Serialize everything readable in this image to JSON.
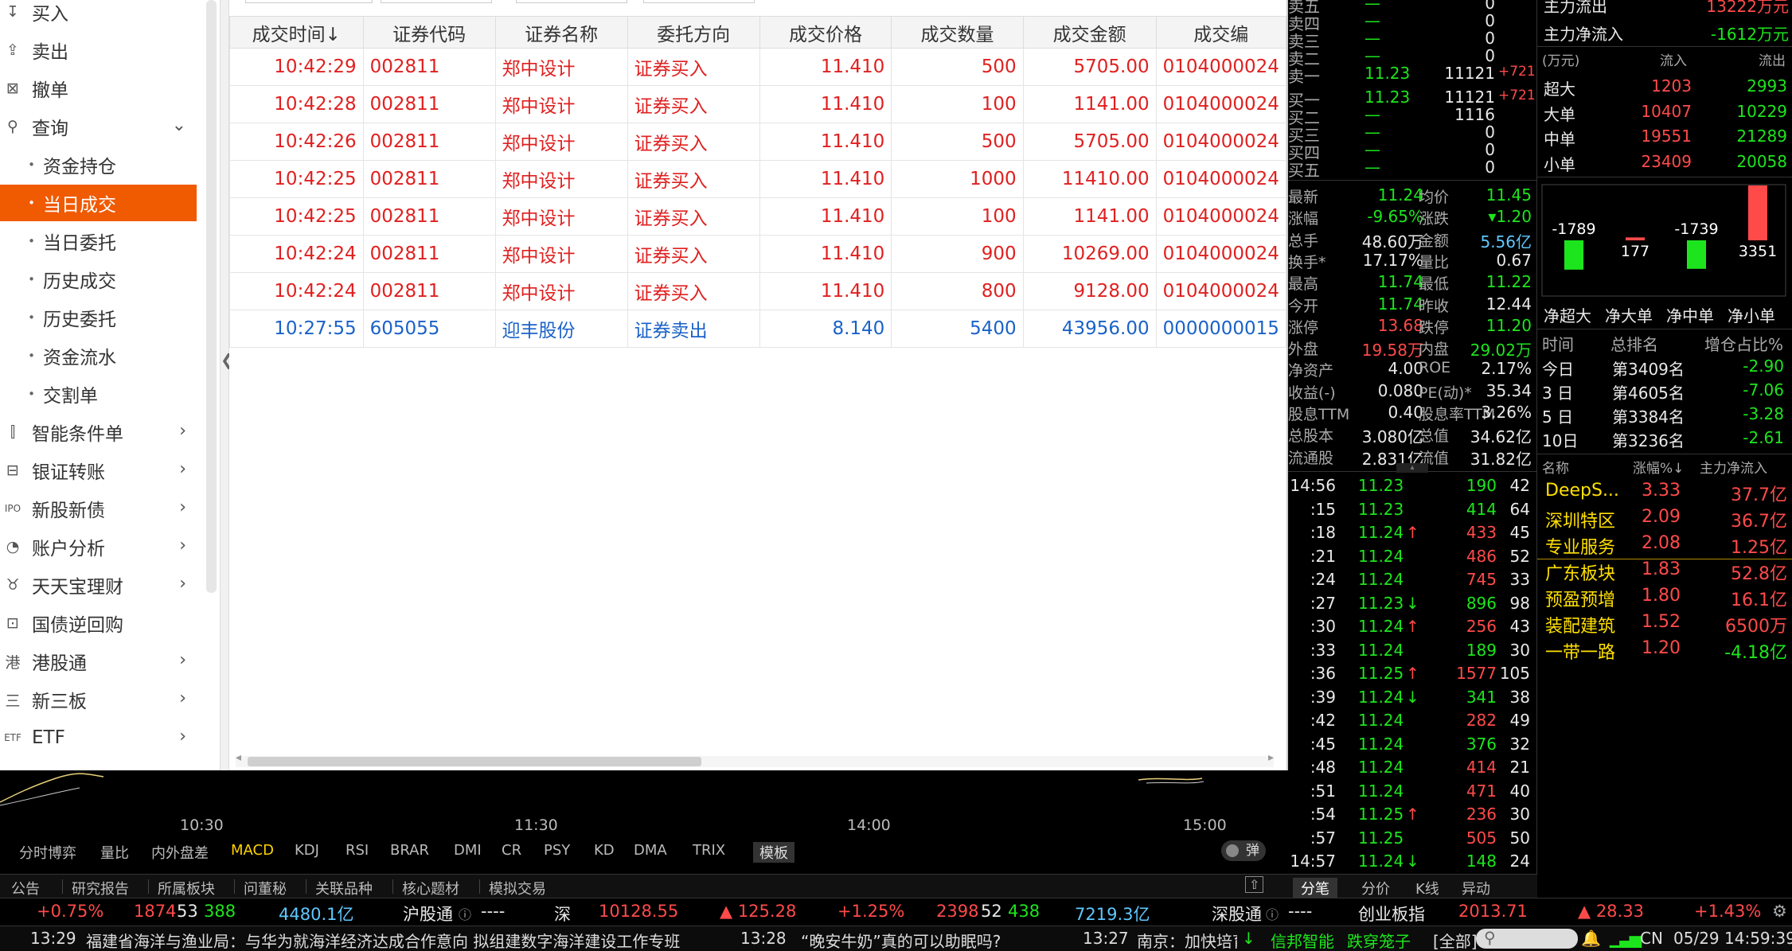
{
  "sidebar": {
    "top_items": [
      {
        "label": "买入",
        "icon": "buy-icon",
        "glyph": "↧"
      },
      {
        "label": "卖出",
        "icon": "sell-icon",
        "glyph": "⇪"
      },
      {
        "label": "撤单",
        "icon": "cancel-order-icon",
        "glyph": "⊠"
      },
      {
        "label": "查询",
        "icon": "search-icon",
        "glyph": "⚲",
        "expanded": true
      }
    ],
    "query_sub": [
      "资金持仓",
      "当日成交",
      "当日委托",
      "历史成交",
      "历史委托",
      "资金流水",
      "交割单"
    ],
    "active_sub": "当日成交",
    "bottom_items": [
      {
        "label": "智能条件单",
        "icon": "smart-order-icon",
        "glyph": "⫿",
        "chevron": true
      },
      {
        "label": "银证转账",
        "icon": "transfer-icon",
        "glyph": "⊟",
        "chevron": true
      },
      {
        "label": "新股新债",
        "icon": "ipo-icon",
        "glyph": "IPO",
        "chevron": true
      },
      {
        "label": "账户分析",
        "icon": "pie-chart-icon",
        "glyph": "◔",
        "chevron": true
      },
      {
        "label": "天天宝理财",
        "icon": "piggy-bank-icon",
        "glyph": "♉",
        "chevron": true
      },
      {
        "label": "国债逆回购",
        "icon": "bond-icon",
        "glyph": "⊡",
        "chevron": false
      },
      {
        "label": "港股通",
        "icon": "hk-connect-icon",
        "glyph": "港",
        "chevron": true
      },
      {
        "label": "新三板",
        "icon": "neeq-icon",
        "glyph": "三",
        "chevron": true
      },
      {
        "label": "ETF",
        "icon": "etf-icon",
        "glyph": "ETF",
        "chevron": true
      }
    ]
  },
  "trades": {
    "columns": [
      "成交时间↓",
      "证券代码",
      "证券名称",
      "委托方向",
      "成交价格",
      "成交数量",
      "成交金额",
      "成交编"
    ],
    "rows": [
      {
        "time": "10:42:29",
        "code": "002811",
        "name": "郑中设计",
        "side": "证券买入",
        "price": "11.410",
        "qty": "500",
        "amount": "5705.00",
        "no": "0104000024",
        "dir": "buy"
      },
      {
        "time": "10:42:28",
        "code": "002811",
        "name": "郑中设计",
        "side": "证券买入",
        "price": "11.410",
        "qty": "100",
        "amount": "1141.00",
        "no": "0104000024",
        "dir": "buy"
      },
      {
        "time": "10:42:26",
        "code": "002811",
        "name": "郑中设计",
        "side": "证券买入",
        "price": "11.410",
        "qty": "500",
        "amount": "5705.00",
        "no": "0104000024",
        "dir": "buy"
      },
      {
        "time": "10:42:25",
        "code": "002811",
        "name": "郑中设计",
        "side": "证券买入",
        "price": "11.410",
        "qty": "1000",
        "amount": "11410.00",
        "no": "0104000024",
        "dir": "buy"
      },
      {
        "time": "10:42:25",
        "code": "002811",
        "name": "郑中设计",
        "side": "证券买入",
        "price": "11.410",
        "qty": "100",
        "amount": "1141.00",
        "no": "0104000024",
        "dir": "buy"
      },
      {
        "time": "10:42:24",
        "code": "002811",
        "name": "郑中设计",
        "side": "证券买入",
        "price": "11.410",
        "qty": "900",
        "amount": "10269.00",
        "no": "0104000024",
        "dir": "buy"
      },
      {
        "time": "10:42:24",
        "code": "002811",
        "name": "郑中设计",
        "side": "证券买入",
        "price": "11.410",
        "qty": "800",
        "amount": "9128.00",
        "no": "0104000024",
        "dir": "buy"
      },
      {
        "time": "10:27:55",
        "code": "605055",
        "name": "迎丰股份",
        "side": "证券卖出",
        "price": "8.140",
        "qty": "5400",
        "amount": "43956.00",
        "no": "0000000015",
        "dir": "sell"
      }
    ]
  },
  "chart": {
    "time_ticks": [
      "10:30",
      "11:30",
      "14:00",
      "15:00"
    ],
    "indicators": [
      "分时博弈",
      "量比",
      "内外盘差",
      "MACD",
      "KDJ",
      "RSI",
      "BRAR",
      "DMI",
      "CR",
      "PSY",
      "KD",
      "DMA",
      "TRIX",
      "模板"
    ],
    "selected_indicator": "MACD",
    "pop_label": "弹"
  },
  "order_book": {
    "asks": [
      {
        "label": "卖五",
        "price": "—",
        "vol": "0",
        "chg": ""
      },
      {
        "label": "卖四",
        "price": "—",
        "vol": "0",
        "chg": ""
      },
      {
        "label": "卖三",
        "price": "—",
        "vol": "0",
        "chg": ""
      },
      {
        "label": "卖二",
        "price": "—",
        "vol": "0",
        "chg": ""
      },
      {
        "label": "卖一",
        "price": "11.23",
        "vol": "11121",
        "chg": "+721"
      }
    ],
    "bids": [
      {
        "label": "买一",
        "price": "11.23",
        "vol": "11121",
        "chg": "+721"
      },
      {
        "label": "买二",
        "price": "—",
        "vol": "1116",
        "chg": ""
      },
      {
        "label": "买三",
        "price": "—",
        "vol": "0",
        "chg": ""
      },
      {
        "label": "买四",
        "price": "—",
        "vol": "0",
        "chg": ""
      },
      {
        "label": "买五",
        "price": "—",
        "vol": "0",
        "chg": ""
      }
    ]
  },
  "stats": [
    {
      "k1": "最新",
      "v1": "11.24",
      "c1": "green",
      "k2": "均价",
      "v2": "11.45",
      "c2": "green"
    },
    {
      "k1": "涨幅",
      "v1": "-9.65%",
      "c1": "green",
      "k2": "涨跌",
      "v2": "▾1.20",
      "c2": "green"
    },
    {
      "k1": "总手",
      "v1": "48.60万",
      "c1": "white",
      "k2": "金额",
      "v2": "5.56亿",
      "c2": "cyan"
    },
    {
      "k1": "换手*",
      "v1": "17.17%",
      "c1": "white",
      "k2": "量比",
      "v2": "0.67",
      "c2": "white"
    },
    {
      "k1": "最高",
      "v1": "11.74",
      "c1": "green",
      "k2": "最低",
      "v2": "11.22",
      "c2": "green"
    },
    {
      "k1": "今开",
      "v1": "11.74",
      "c1": "green",
      "k2": "昨收",
      "v2": "12.44",
      "c2": "white"
    },
    {
      "k1": "涨停",
      "v1": "13.68",
      "c1": "red",
      "k2": "跌停",
      "v2": "11.20",
      "c2": "green"
    },
    {
      "k1": "外盘",
      "v1": "19.58万",
      "c1": "red",
      "k2": "内盘",
      "v2": "29.02万",
      "c2": "green"
    },
    {
      "k1": "净资产",
      "v1": "4.00",
      "c1": "white",
      "k2": "ROE",
      "v2": "2.17%",
      "c2": "white"
    },
    {
      "k1": "收益(-)",
      "v1": "0.080",
      "c1": "white",
      "k2": "PE(动)*",
      "v2": "35.34",
      "c2": "white"
    },
    {
      "k1": "股息TTM",
      "v1": "0.40",
      "c1": "white",
      "k2": "股息率TTM",
      "v2": "3.26%",
      "c2": "white"
    },
    {
      "k1": "总股本",
      "v1": "3.080亿",
      "c1": "white",
      "k2": "总值",
      "v2": "34.62亿",
      "c2": "white"
    },
    {
      "k1": "流通股",
      "v1": "2.831亿",
      "c1": "white",
      "k2": "流值",
      "v2": "31.82亿",
      "c2": "white"
    }
  ],
  "ticks": [
    {
      "t": "14:56",
      "p": "11.23",
      "a": "",
      "v": "190",
      "n": "42",
      "vc": "green"
    },
    {
      "t": ":15",
      "p": "11.23",
      "a": "",
      "v": "414",
      "n": "64",
      "vc": "green"
    },
    {
      "t": ":18",
      "p": "11.24",
      "a": "↑",
      "v": "433",
      "n": "45",
      "vc": "red"
    },
    {
      "t": ":21",
      "p": "11.24",
      "a": "",
      "v": "486",
      "n": "52",
      "vc": "red"
    },
    {
      "t": ":24",
      "p": "11.24",
      "a": "",
      "v": "745",
      "n": "33",
      "vc": "red"
    },
    {
      "t": ":27",
      "p": "11.23",
      "a": "↓",
      "v": "896",
      "n": "98",
      "vc": "green"
    },
    {
      "t": ":30",
      "p": "11.24",
      "a": "↑",
      "v": "256",
      "n": "43",
      "vc": "red"
    },
    {
      "t": ":33",
      "p": "11.24",
      "a": "",
      "v": "189",
      "n": "30",
      "vc": "green"
    },
    {
      "t": ":36",
      "p": "11.25",
      "a": "↑",
      "v": "1577",
      "n": "105",
      "vc": "red"
    },
    {
      "t": ":39",
      "p": "11.24",
      "a": "↓",
      "v": "341",
      "n": "38",
      "vc": "green"
    },
    {
      "t": ":42",
      "p": "11.24",
      "a": "",
      "v": "282",
      "n": "49",
      "vc": "red"
    },
    {
      "t": ":45",
      "p": "11.24",
      "a": "",
      "v": "376",
      "n": "32",
      "vc": "green"
    },
    {
      "t": ":48",
      "p": "11.24",
      "a": "",
      "v": "414",
      "n": "21",
      "vc": "red"
    },
    {
      "t": ":51",
      "p": "11.24",
      "a": "",
      "v": "471",
      "n": "40",
      "vc": "red"
    },
    {
      "t": ":54",
      "p": "11.25",
      "a": "↑",
      "v": "236",
      "n": "30",
      "vc": "red"
    },
    {
      "t": ":57",
      "p": "11.25",
      "a": "",
      "v": "505",
      "n": "50",
      "vc": "red"
    },
    {
      "t": "14:57",
      "p": "11.24",
      "a": "↓",
      "v": "148",
      "n": "24",
      "vc": "green"
    }
  ],
  "quote_tabs": [
    "分笔",
    "分价",
    "K线",
    "异动"
  ],
  "flow": {
    "top_rows": [
      {
        "label": "主力流出",
        "value": "13222万元"
      },
      {
        "label": "主力净流入",
        "value": "-1612万元"
      }
    ],
    "header": {
      "unit": "(万元)",
      "in": "流入",
      "out": "流出"
    },
    "rows": [
      {
        "label": "超大",
        "in": "1203",
        "out": "2993"
      },
      {
        "label": "大单",
        "in": "10407",
        "out": "10229"
      },
      {
        "label": "中单",
        "in": "19551",
        "out": "21289"
      },
      {
        "label": "小单",
        "in": "23409",
        "out": "20058"
      }
    ],
    "net_chart": {
      "type": "bar",
      "categories": [
        "净超大",
        "净大单",
        "净中单",
        "净小单"
      ],
      "values": [
        -1789,
        177,
        -1739,
        3351
      ]
    },
    "rank": {
      "header": [
        "时间",
        "总排名",
        "增仓占比%"
      ],
      "rows": [
        {
          "period": "今日",
          "rank": "第3409名",
          "pct": "-2.90"
        },
        {
          "period": "3 日",
          "rank": "第4605名",
          "pct": "-7.06"
        },
        {
          "period": "5 日",
          "rank": "第3384名",
          "pct": "-3.28"
        },
        {
          "period": "10日",
          "rank": "第3236名",
          "pct": "-2.61"
        }
      ]
    },
    "sectors": {
      "header": [
        "名称",
        "涨幅%↓",
        "主力净流入"
      ],
      "rows": [
        {
          "name": "DeepS...",
          "pct": "3.33",
          "flow": "37.7亿"
        },
        {
          "name": "深圳特区",
          "pct": "2.09",
          "flow": "36.7亿"
        },
        {
          "name": "专业服务",
          "pct": "2.08",
          "flow": "1.25亿"
        },
        {
          "name": "广东板块",
          "pct": "1.83",
          "flow": "52.8亿"
        },
        {
          "name": "预盈预增",
          "pct": "1.80",
          "flow": "16.1亿"
        },
        {
          "name": "装配建筑",
          "pct": "1.52",
          "flow": "6500万"
        },
        {
          "name": "一带一路",
          "pct": "1.20",
          "flow": "-4.18亿"
        }
      ]
    }
  },
  "bottom_tabs": [
    "公告",
    "研究报告",
    "所属板块",
    "问董秘",
    "关联品种",
    "核心题材",
    "模拟交易"
  ],
  "index_bar": {
    "sh_pct": "+0.75%",
    "sh_up": "1874",
    "sh_flat": "53",
    "sh_down": "388",
    "sh_amt": "4480.1亿",
    "hgt_label": "沪股通",
    "hgt_val": "----",
    "sz_label": "深",
    "sz_val": "10128.55",
    "sz_chg": "▲ 125.28",
    "sz_pct": "+1.25%",
    "sz_up": "2398",
    "sz_flat": "52",
    "sz_down": "438",
    "sz_amt": "7219.3亿",
    "sgt_label": "深股通",
    "sgt_val": "----",
    "cyb_label": "创业板指",
    "cyb_val": "2013.71",
    "cyb_chg": "▲ 28.33",
    "cyb_pct": "+1.43%"
  },
  "news_bar": {
    "items": [
      {
        "time": "13:29",
        "text": "福建省海洋与渔业局：与华为就海洋经济达成合作意向 拟组建数字海洋建设工作专班"
      },
      {
        "time": "13:28",
        "text": "“晚安牛奶”真的可以助眠吗?"
      },
      {
        "time": "13:27",
        "text": "南京：加快培育"
      }
    ],
    "marquee_arrow": "↓",
    "stock1": "信邦智能",
    "stock2": "跌穿笼子",
    "filter": "[全部]",
    "lang": "CN",
    "date": "05/29",
    "clock": "14:59:39"
  }
}
